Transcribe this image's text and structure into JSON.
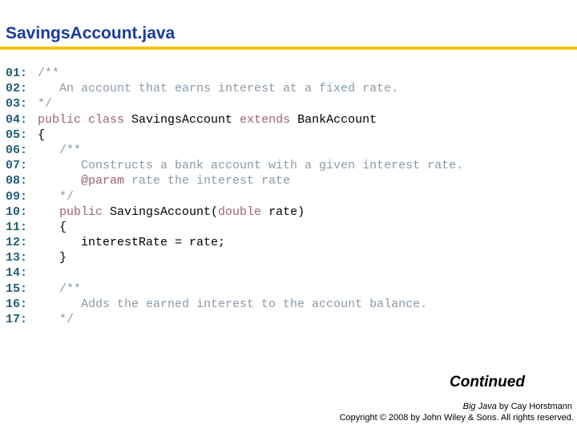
{
  "title": "SavingsAccount.java",
  "code_lines": [
    {
      "num": "01:",
      "segments": [
        {
          "t": "/**",
          "c": "cm"
        }
      ]
    },
    {
      "num": "02:",
      "segments": [
        {
          "t": "   An account that earns interest at a fixed rate.",
          "c": "cm"
        }
      ]
    },
    {
      "num": "03:",
      "segments": [
        {
          "t": "*/",
          "c": "cm"
        }
      ]
    },
    {
      "num": "04:",
      "segments": [
        {
          "t": "public class ",
          "c": "kw"
        },
        {
          "t": "SavingsAccount ",
          "c": "tx"
        },
        {
          "t": "extends ",
          "c": "kw"
        },
        {
          "t": "BankAccount",
          "c": "tx"
        }
      ]
    },
    {
      "num": "05:",
      "segments": [
        {
          "t": "{",
          "c": "tx"
        }
      ]
    },
    {
      "num": "06:",
      "segments": [
        {
          "t": "   /**",
          "c": "cm"
        }
      ]
    },
    {
      "num": "07:",
      "segments": [
        {
          "t": "      Constructs a bank account with a given interest rate.",
          "c": "cm"
        }
      ]
    },
    {
      "num": "08:",
      "segments": [
        {
          "t": "      ",
          "c": "cm"
        },
        {
          "t": "@param",
          "c": "kw"
        },
        {
          "t": " rate the interest rate",
          "c": "cm"
        }
      ]
    },
    {
      "num": "09:",
      "segments": [
        {
          "t": "   */",
          "c": "cm"
        }
      ]
    },
    {
      "num": "10:",
      "segments": [
        {
          "t": "   public ",
          "c": "kw"
        },
        {
          "t": "SavingsAccount(",
          "c": "tx"
        },
        {
          "t": "double",
          "c": "kw"
        },
        {
          "t": " rate)",
          "c": "tx"
        }
      ]
    },
    {
      "num": "11:",
      "segments": [
        {
          "t": "   {",
          "c": "tx"
        }
      ]
    },
    {
      "num": "12:",
      "segments": [
        {
          "t": "      interestRate = rate;",
          "c": "tx"
        }
      ]
    },
    {
      "num": "13:",
      "segments": [
        {
          "t": "   }",
          "c": "tx"
        }
      ]
    },
    {
      "num": "14:",
      "segments": [
        {
          "t": "",
          "c": "tx"
        }
      ]
    },
    {
      "num": "15:",
      "segments": [
        {
          "t": "   /**",
          "c": "cm"
        }
      ]
    },
    {
      "num": "16:",
      "segments": [
        {
          "t": "      Adds the earned interest to the account balance.",
          "c": "cm"
        }
      ]
    },
    {
      "num": "17:",
      "segments": [
        {
          "t": "   */",
          "c": "cm"
        }
      ]
    }
  ],
  "continued": "Continued",
  "credit": {
    "book": "Big Java",
    "by_author": " by Cay Horstmann",
    "copyright": "Copyright © 2008 by John Wiley & Sons.  All rights reserved."
  },
  "colors": {
    "title": "#1a3a9e",
    "rule": "#f5c518",
    "line_number": "#1f5f7a",
    "comment": "#8a9aa8",
    "keyword": "#a0607a"
  }
}
